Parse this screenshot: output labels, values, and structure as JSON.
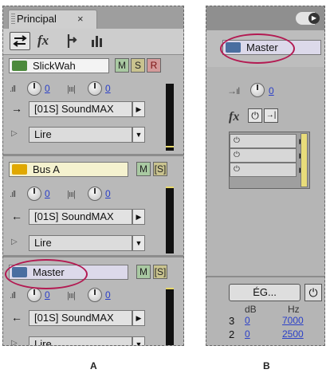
{
  "panel_a": {
    "tab": {
      "label": "Principal",
      "close": "×"
    },
    "toolbar": {
      "fx_label": "fx"
    },
    "track1": {
      "name": "SlickWah",
      "m": "M",
      "s": "S",
      "r": "R",
      "volume": "0",
      "pan": "0",
      "output": "[01S] SoundMAX",
      "mode": "Lire"
    },
    "bus": {
      "name": "Bus A",
      "m": "M",
      "s": "[S]",
      "volume": "0",
      "pan": "0",
      "output": "[01S] SoundMAX",
      "mode": "Lire"
    },
    "master": {
      "name": "Master",
      "m": "M",
      "s": "[S]",
      "volume": "0",
      "pan": "0",
      "output": "[01S] SoundMAX",
      "mode": "Lire"
    }
  },
  "panel_b": {
    "master_name": "Master",
    "send_value": "0",
    "fx_label": "fx",
    "eq_button": "ÉG...",
    "eq_headers": {
      "db": "dB",
      "hz": "Hz"
    },
    "eq_rows": [
      {
        "band": "3",
        "db": "0",
        "hz": "7000"
      },
      {
        "band": "2",
        "db": "0",
        "hz": "2500"
      }
    ]
  },
  "captions": {
    "a": "A",
    "b": "B"
  },
  "colors": {
    "highlight": "#b31a52",
    "value_link": "#2b40c8",
    "meter_yellow": "#e7d86a"
  }
}
